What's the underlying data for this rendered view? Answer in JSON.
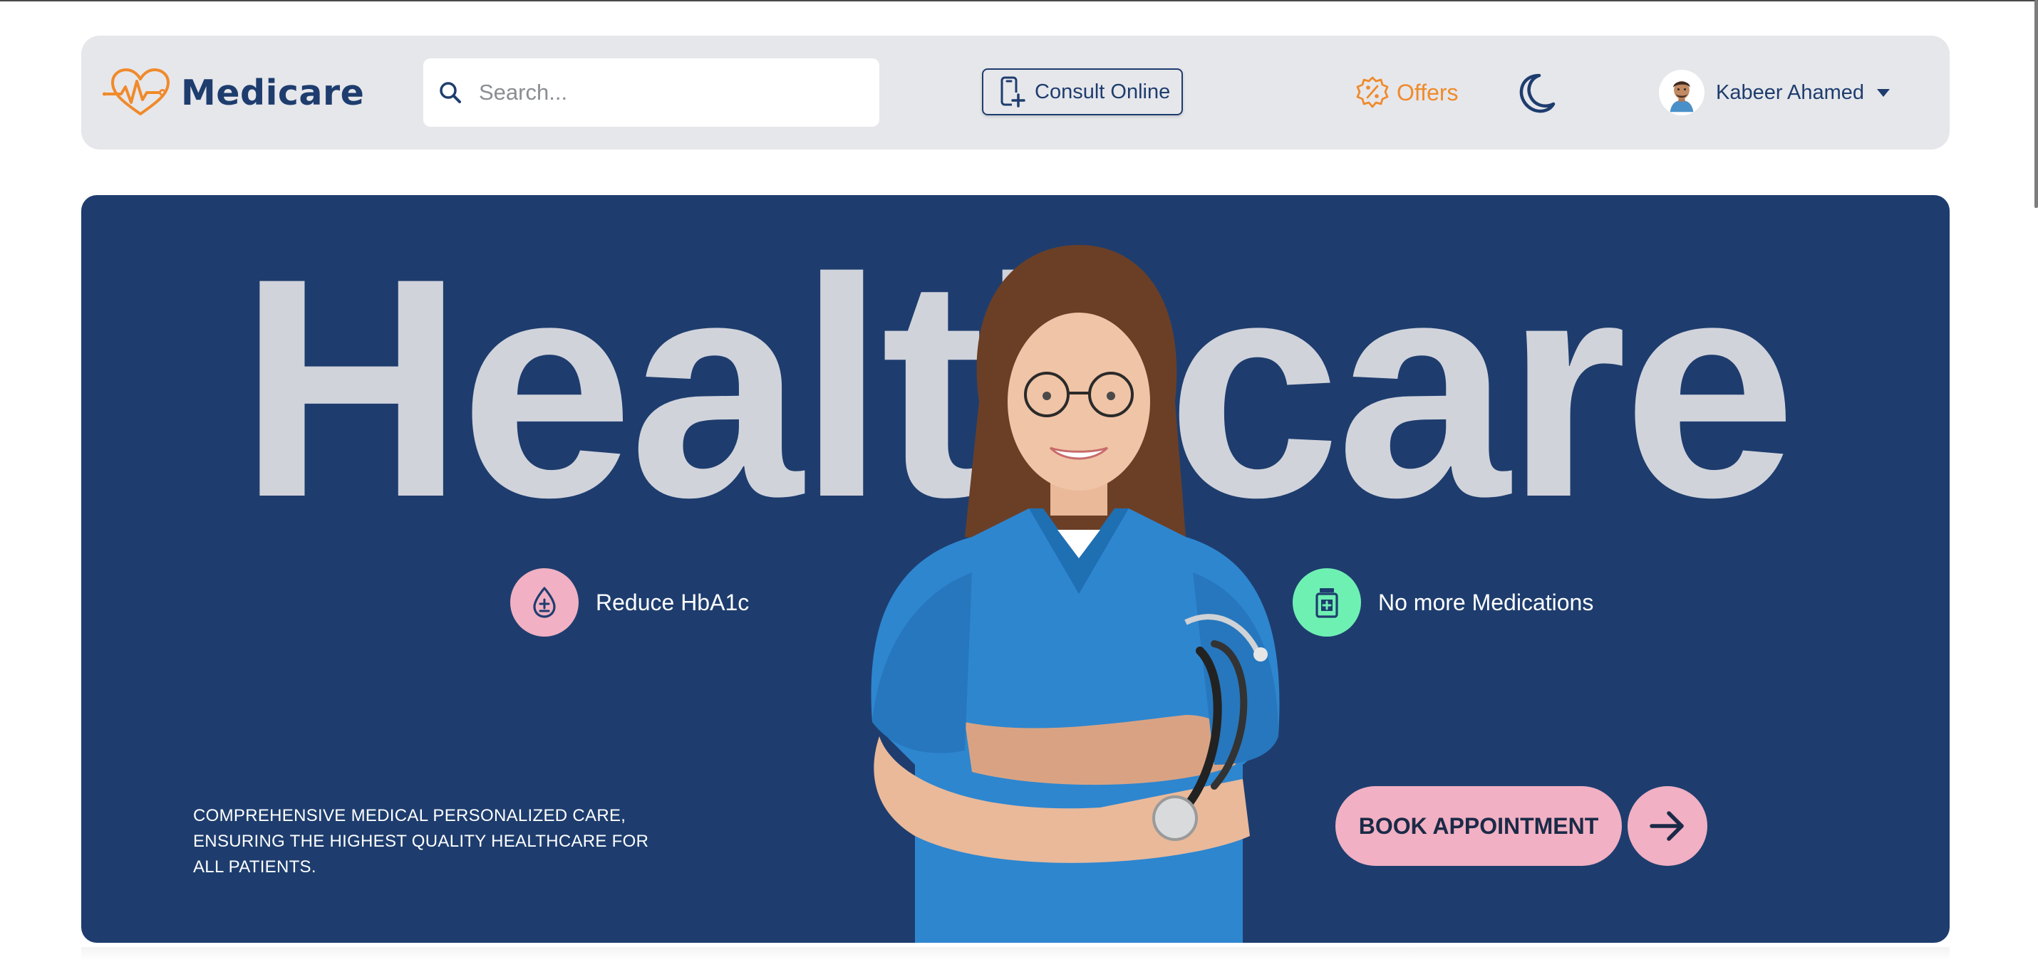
{
  "brand": {
    "name": "Medicare",
    "logo_icon": "heart-pulse-icon",
    "accent": "#f08a2b",
    "primary": "#1e3d6e"
  },
  "search": {
    "placeholder": "Search...",
    "value": ""
  },
  "nav": {
    "consult_label": "Consult Online",
    "offers_label": "Offers",
    "theme_icon": "moon-icon",
    "user_name": "Kabeer Ahamed"
  },
  "hero": {
    "headline": "Healthcare",
    "features": [
      {
        "label": "Reduce HbA1c",
        "icon": "blood-drop-icon",
        "color": "#f1b0c3"
      },
      {
        "label": "No more Medications",
        "icon": "medicine-bottle-icon",
        "color": "#6ff0b3"
      }
    ],
    "tagline": "COMPREHENSIVE MEDICAL PERSONALIZED CARE, ENSURING THE HIGHEST QUALITY HEALTHCARE FOR ALL PATIENTS.",
    "cta_label": "BOOK APPOINTMENT",
    "cta_color": "#f1b0c3",
    "background": "#1e3d6e"
  }
}
